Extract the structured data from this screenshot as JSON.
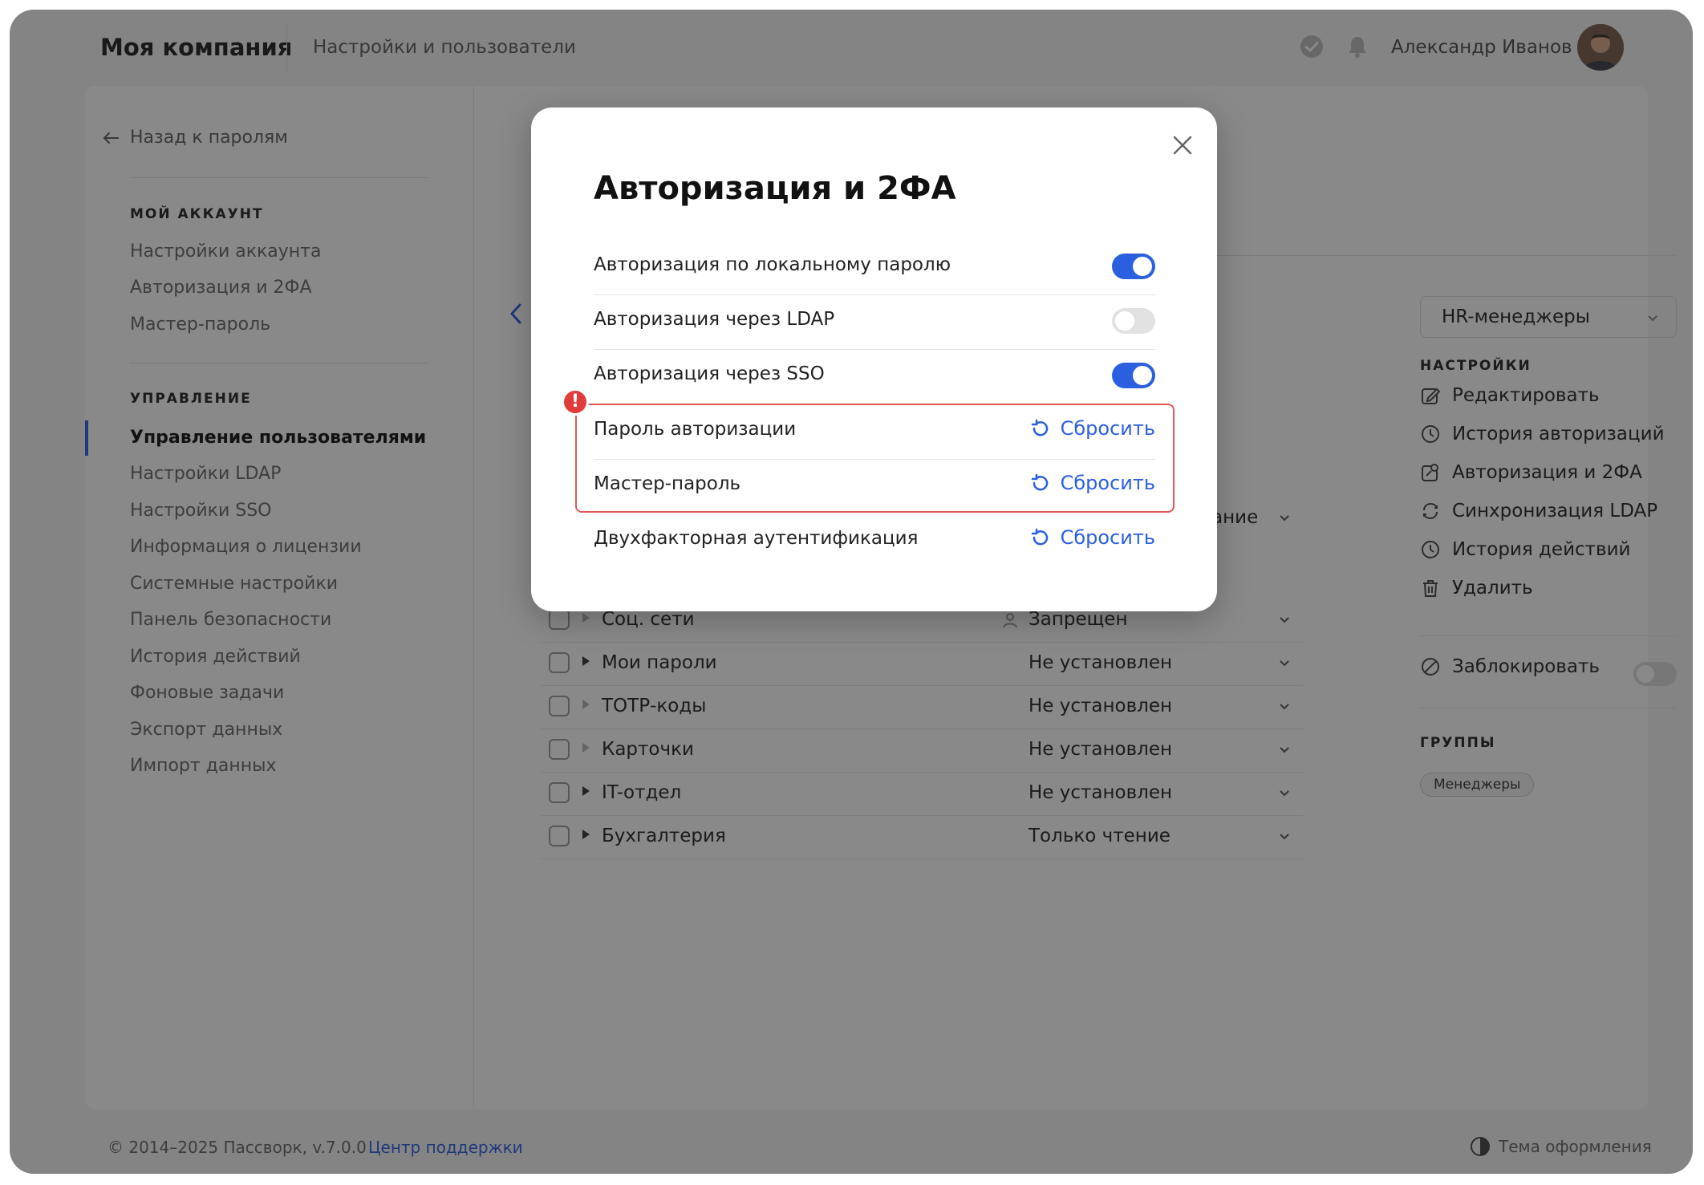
{
  "header": {
    "brand": "Моя компания",
    "section": "Настройки и пользователи",
    "user_name": "Александр Иванов"
  },
  "sidebar": {
    "back": "Назад к паролям",
    "account_heading": "МОЙ АККАУНТ",
    "account_items": [
      "Настройки аккаунта",
      "Авторизация и 2ФА",
      "Мастер-пароль"
    ],
    "manage_heading": "УПРАВЛЕНИЕ",
    "manage_items": [
      "Управление пользователями",
      "Настройки LDAP",
      "Настройки SSO",
      "Информация о лицензии",
      "Системные настройки",
      "Панель безопасности",
      "История действий",
      "Фоновые задачи",
      "Экспорт данных",
      "Импорт данных"
    ]
  },
  "table": {
    "partial_access": "ание",
    "rows": [
      {
        "name": "Соц. сети",
        "access": "Запрещен"
      },
      {
        "name": "Мои пароли",
        "access": "Не установлен"
      },
      {
        "name": "ТОТР-коды",
        "access": "Не установлен"
      },
      {
        "name": "Карточки",
        "access": "Не установлен"
      },
      {
        "name": "IT-отдел",
        "access": "Не установлен"
      },
      {
        "name": "Бухгалтерия",
        "access": "Только чтение"
      }
    ]
  },
  "right_panel": {
    "group_select": "HR-менеджеры",
    "settings_heading": "НАСТРОЙКИ",
    "settings_items": [
      {
        "label": "Редактировать",
        "icon": "edit-icon"
      },
      {
        "label": "История авторизаций",
        "icon": "clock-icon"
      },
      {
        "label": "Авторизация и 2ФА",
        "icon": "auth-edit-icon"
      },
      {
        "label": "Синхронизация LDAP",
        "icon": "sync-icon"
      },
      {
        "label": "История действий",
        "icon": "clock-icon"
      },
      {
        "label": "Удалить",
        "icon": "trash-icon"
      }
    ],
    "block_label": "Заблокировать",
    "groups_heading": "ГРУППЫ",
    "group_tag": "Менеджеры"
  },
  "footer": {
    "copyright": "© 2014–2025 Пассворк, v.7.0.0",
    "support": "Центр поддержки",
    "theme": "Тема оформления"
  },
  "modal": {
    "title": "Авторизация и 2ФА",
    "toggles": [
      {
        "label": "Авторизация по локальному паролю",
        "on": true
      },
      {
        "label": "Авторизация через LDAP",
        "on": false
      },
      {
        "label": "Авторизация через SSO",
        "on": true
      }
    ],
    "resets": [
      {
        "label": "Пароль авторизации",
        "action": "Сбросить"
      },
      {
        "label": "Мастер-пароль",
        "action": "Сбросить"
      },
      {
        "label": "Двухфакторная аутентификация",
        "action": "Сбросить"
      }
    ],
    "alert_glyph": "!"
  },
  "colors": {
    "accent": "#2c5fe0",
    "alert": "#e23b3b"
  }
}
